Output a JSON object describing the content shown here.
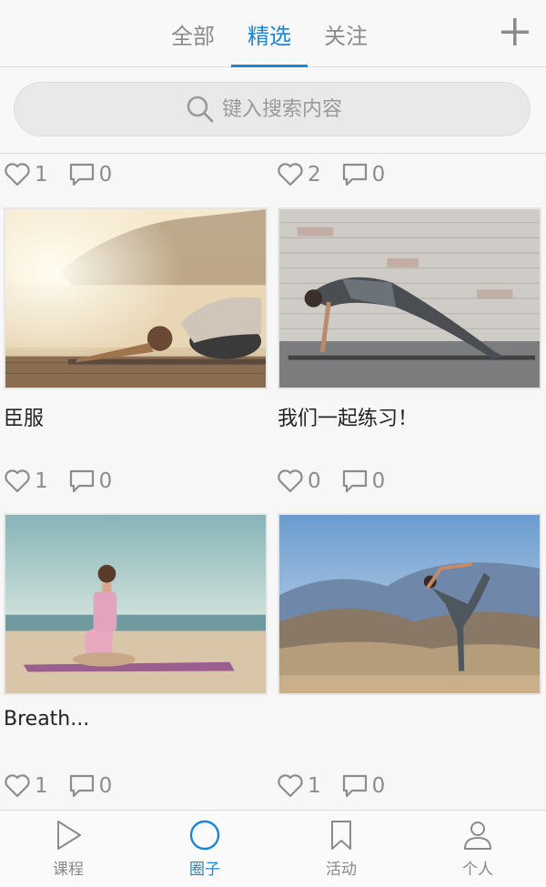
{
  "header": {
    "tabs": [
      {
        "label": "全部",
        "active": false
      },
      {
        "label": "精选",
        "active": true
      },
      {
        "label": "关注",
        "active": false
      }
    ],
    "add_icon": "plus-icon"
  },
  "search": {
    "placeholder": "键入搜索内容",
    "icon": "search-icon"
  },
  "feed": {
    "top_stats": [
      {
        "likes": "1",
        "comments": "0"
      },
      {
        "likes": "2",
        "comments": "0"
      }
    ],
    "posts": [
      {
        "title": "臣服",
        "likes": "1",
        "comments": "0",
        "image": "yoga-child-pose-sunset"
      },
      {
        "title": "我们一起练习！",
        "likes": "0",
        "comments": "0",
        "image": "yoga-upward-plank-brick-wall"
      },
      {
        "title": "Breath...",
        "likes": "1",
        "comments": "0",
        "image": "yoga-meditation-beach"
      },
      {
        "title": "",
        "likes": "1",
        "comments": "0",
        "image": "yoga-dancer-pose-mountains"
      }
    ]
  },
  "bottom_nav": {
    "items": [
      {
        "label": "课程",
        "icon": "play-icon",
        "active": false
      },
      {
        "label": "圈子",
        "icon": "circle-icon",
        "active": true
      },
      {
        "label": "活动",
        "icon": "bookmark-icon",
        "active": false
      },
      {
        "label": "个人",
        "icon": "person-icon",
        "active": false
      }
    ]
  },
  "colors": {
    "accent": "#1a86d8",
    "muted": "#8a8a8a",
    "background": "#f7f7f7"
  }
}
